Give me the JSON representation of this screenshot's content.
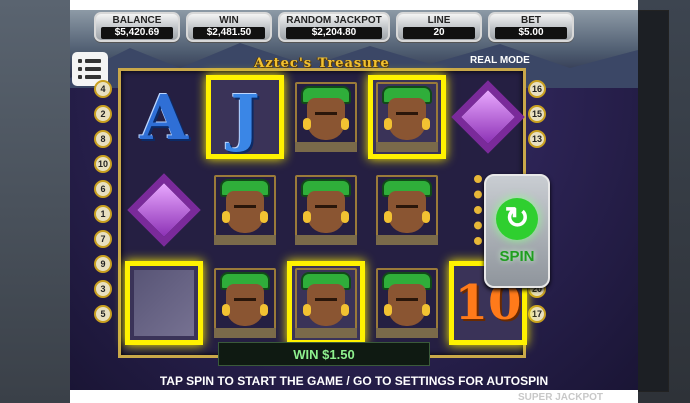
{
  "stats": [
    {
      "label": "BALANCE",
      "value": "$5,420.69"
    },
    {
      "label": "WIN",
      "value": "$2,481.50"
    },
    {
      "label": "RANDOM JACKPOT",
      "value": "$2,204.80"
    },
    {
      "label": "LINE",
      "value": "20"
    },
    {
      "label": "BET",
      "value": "$5.00"
    }
  ],
  "game_title": "Aztec's Treasure",
  "mode": "REAL MODE",
  "left_lines": [
    "4",
    "2",
    "8",
    "10",
    "6",
    "1",
    "7",
    "9",
    "3",
    "5"
  ],
  "right_lines": [
    "16",
    "15",
    "13",
    "",
    "",
    "",
    "",
    "12",
    "20",
    "17"
  ],
  "reels": [
    [
      "A",
      "J",
      "face",
      "face",
      "Q"
    ],
    [
      "Q",
      "face",
      "face",
      "face",
      "beads"
    ],
    [
      "ghost",
      "face",
      "face",
      "face",
      "10"
    ]
  ],
  "win_cells": [
    [
      0,
      1
    ],
    [
      0,
      3
    ],
    [
      2,
      0
    ],
    [
      2,
      2
    ],
    [
      2,
      4
    ]
  ],
  "spin_label": "SPIN",
  "win_text": "WIN $1.50",
  "hint": "TAP SPIN TO START THE GAME / GO TO SETTINGS FOR AUTOSPIN",
  "footer_label": "SUPER JACKPOT"
}
